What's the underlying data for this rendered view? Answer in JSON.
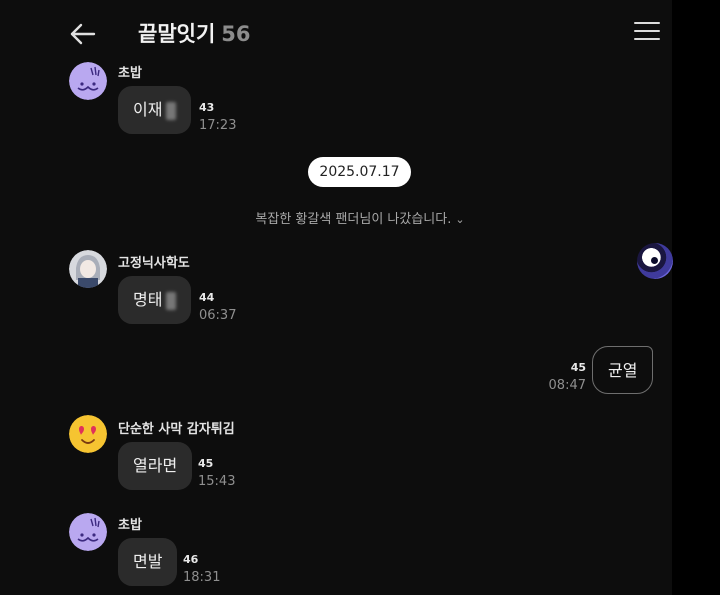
{
  "header": {
    "back_icon": "arrow-left-icon",
    "title": "끝말잇기",
    "member_count": "56",
    "menu_icon": "hamburger-menu-icon"
  },
  "messages_before": [
    {
      "sender": "초밥",
      "text": "이재",
      "unread": "43",
      "time": "17:23"
    }
  ],
  "date_divider": "2025.07.17",
  "system_notice": {
    "text": "복잡한 황갈색 팬더님이 나갔습니다.",
    "chevron_icon": "chevron-down-icon"
  },
  "messages_after": [
    {
      "sender": "고정닉사학도",
      "text": "명태",
      "unread": "44",
      "time": "06:37"
    },
    {
      "mine": true,
      "text": "균열",
      "unread": "45",
      "time": "08:47"
    },
    {
      "sender": "단순한 사막 감자튀김",
      "text": "열라면",
      "unread": "45",
      "time": "15:43"
    },
    {
      "sender": "초밥",
      "text": "면발",
      "unread": "46",
      "time": "18:31"
    }
  ],
  "colors": {
    "background": "#0d0d0d",
    "bubble": "#2b2b2b",
    "date_pill": "#ffffff",
    "avatar_purple": "#b9a8f0",
    "avatar_yellow": "#f6c431"
  }
}
